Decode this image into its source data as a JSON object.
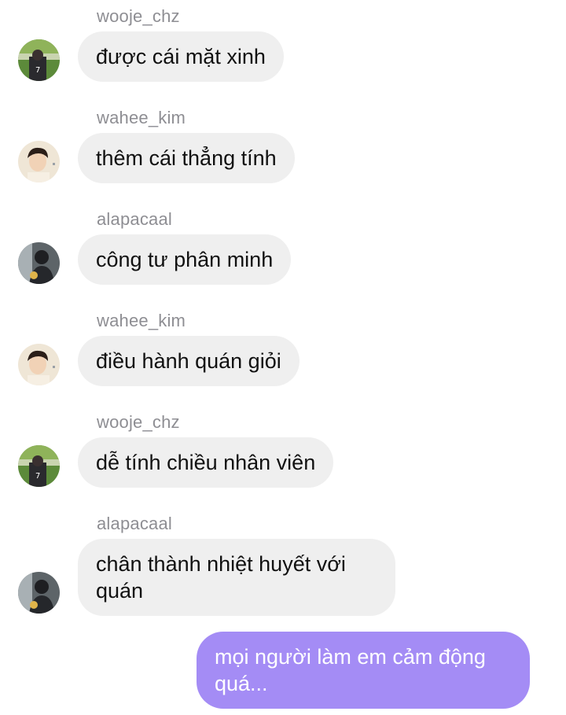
{
  "messages": [
    {
      "username": "wooje_chz",
      "text": "được cái mặt xinh",
      "avatar": "stadium-avatar"
    },
    {
      "username": "wahee_kim",
      "text": "thêm cái thẳng tính",
      "avatar": "portrait-avatar"
    },
    {
      "username": "alapacaal",
      "text": "công tư phân minh",
      "avatar": "dark-avatar"
    },
    {
      "username": "wahee_kim",
      "text": "điều hành quán giỏi",
      "avatar": "portrait-avatar"
    },
    {
      "username": "wooje_chz",
      "text": "dễ tính chiều nhân viên",
      "avatar": "stadium-avatar"
    },
    {
      "username": "alapacaal",
      "text": "chân thành nhiệt huyết với quán",
      "avatar": "dark-avatar"
    }
  ],
  "outgoing": {
    "text": "mọi người làm em cảm động quá..."
  },
  "colors": {
    "incoming_bubble": "#efefef",
    "outgoing_bubble": "#a48cf5",
    "username": "#8e8e93"
  }
}
